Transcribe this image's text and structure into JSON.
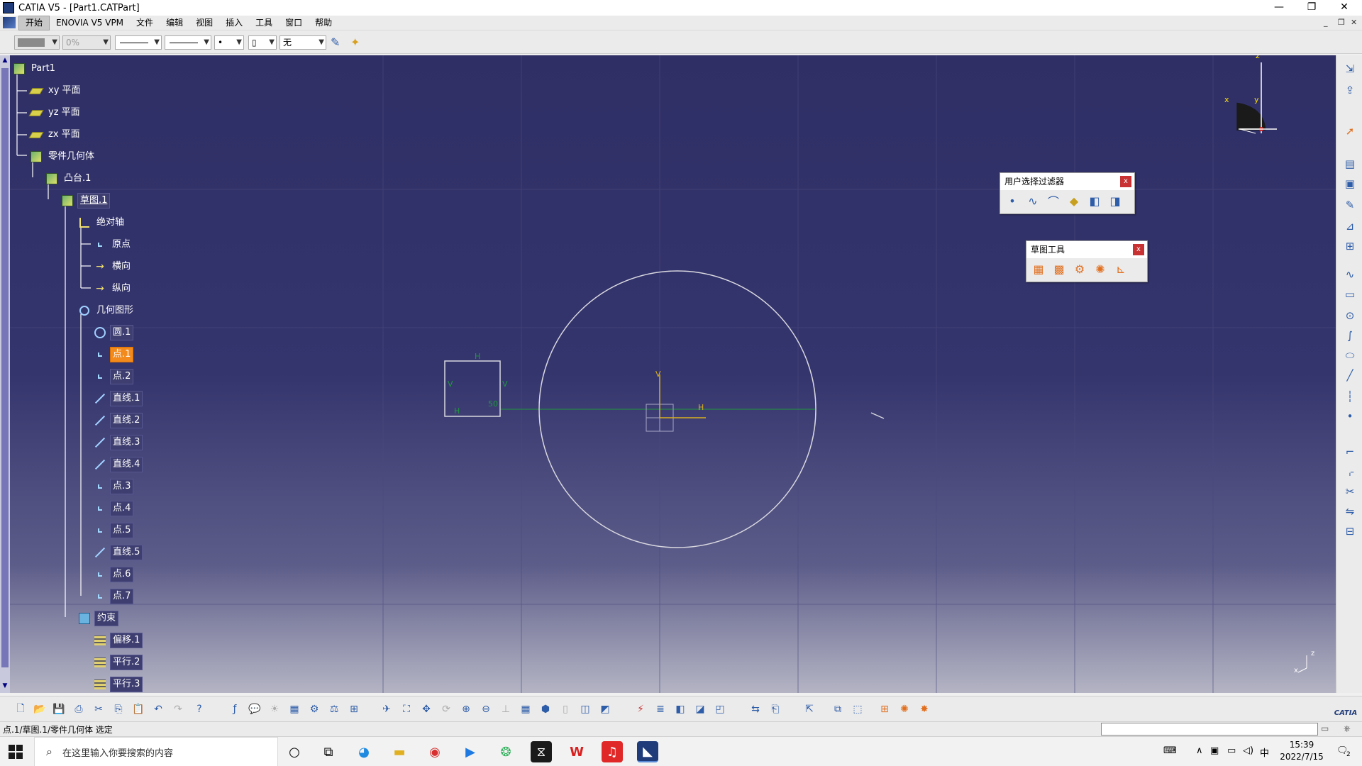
{
  "window": {
    "title": "CATIA V5 - [Part1.CATPart]",
    "minimize": "—",
    "restore": "❐",
    "close": "✕"
  },
  "menu": {
    "items": [
      "开始",
      "ENOVIA V5 VPM",
      "文件",
      "编辑",
      "视图",
      "插入",
      "工具",
      "窗口",
      "帮助"
    ],
    "active_index": 0
  },
  "toolbar_top": {
    "transparency": "0%",
    "layer": "无"
  },
  "tree": {
    "nodes": [
      {
        "label": "Part1",
        "depth": 0,
        "icon": "part-icon"
      },
      {
        "label": "xy 平面",
        "depth": 1,
        "icon": "plane-icon"
      },
      {
        "label": "yz 平面",
        "depth": 1,
        "icon": "plane-icon"
      },
      {
        "label": "zx 平面",
        "depth": 1,
        "icon": "plane-icon"
      },
      {
        "label": "零件几何体",
        "depth": 1,
        "icon": "body-icon"
      },
      {
        "label": "凸台.1",
        "depth": 2,
        "icon": "pad-icon"
      },
      {
        "label": "草图.1",
        "depth": 3,
        "icon": "sketch-icon"
      },
      {
        "label": "绝对轴",
        "depth": 4,
        "icon": "axis-icon"
      },
      {
        "label": "原点",
        "depth": 5,
        "icon": "point-icon"
      },
      {
        "label": "横向",
        "depth": 5,
        "icon": "arrow-icon"
      },
      {
        "label": "纵向",
        "depth": 5,
        "icon": "arrow-icon"
      },
      {
        "label": "几何图形",
        "depth": 4,
        "icon": "geometry-icon"
      },
      {
        "label": "圆.1",
        "depth": 5,
        "icon": "circle-icon"
      },
      {
        "label": "点.1",
        "depth": 5,
        "icon": "point-icon"
      },
      {
        "label": "点.2",
        "depth": 5,
        "icon": "point-icon"
      },
      {
        "label": "直线.1",
        "depth": 5,
        "icon": "line-icon"
      },
      {
        "label": "直线.2",
        "depth": 5,
        "icon": "line-icon"
      },
      {
        "label": "直线.3",
        "depth": 5,
        "icon": "line-icon"
      },
      {
        "label": "直线.4",
        "depth": 5,
        "icon": "line-icon"
      },
      {
        "label": "点.3",
        "depth": 5,
        "icon": "point-icon"
      },
      {
        "label": "点.4",
        "depth": 5,
        "icon": "point-icon"
      },
      {
        "label": "点.5",
        "depth": 5,
        "icon": "point-icon"
      },
      {
        "label": "直线.5",
        "depth": 5,
        "icon": "line-icon"
      },
      {
        "label": "点.6",
        "depth": 5,
        "icon": "point-icon"
      },
      {
        "label": "点.7",
        "depth": 5,
        "icon": "point-icon"
      },
      {
        "label": "约束",
        "depth": 4,
        "icon": "constraint-icon"
      },
      {
        "label": "偏移.1",
        "depth": 5,
        "icon": "offset-icon"
      },
      {
        "label": "平行.2",
        "depth": 5,
        "icon": "parallel-icon"
      },
      {
        "label": "平行.3",
        "depth": 5,
        "icon": "parallel-icon"
      }
    ],
    "selected": "点.1"
  },
  "sketch": {
    "constraint_labels": {
      "h": "H",
      "v": "V",
      "dim": "50"
    }
  },
  "compass": {
    "z": "z",
    "x": "x",
    "y": "y"
  },
  "small_axis": {
    "z": "z",
    "x": "x"
  },
  "filter_toolbar": {
    "title": "用户选择过滤器",
    "close": "x"
  },
  "sketch_tools": {
    "title": "草图工具",
    "close": "x"
  },
  "status": {
    "message": "点.1/草图.1/零件几何体 选定"
  },
  "taskbar": {
    "search_placeholder": "在这里输入你要搜索的内容",
    "time": "15:39",
    "date": "2022/7/15",
    "ime": "中",
    "notifications": "2"
  },
  "colors": {
    "selected": "#f28a1d",
    "sketch_line": "#d8d8e0",
    "construction": "#1e9a3a",
    "axis": "#d8b020"
  }
}
